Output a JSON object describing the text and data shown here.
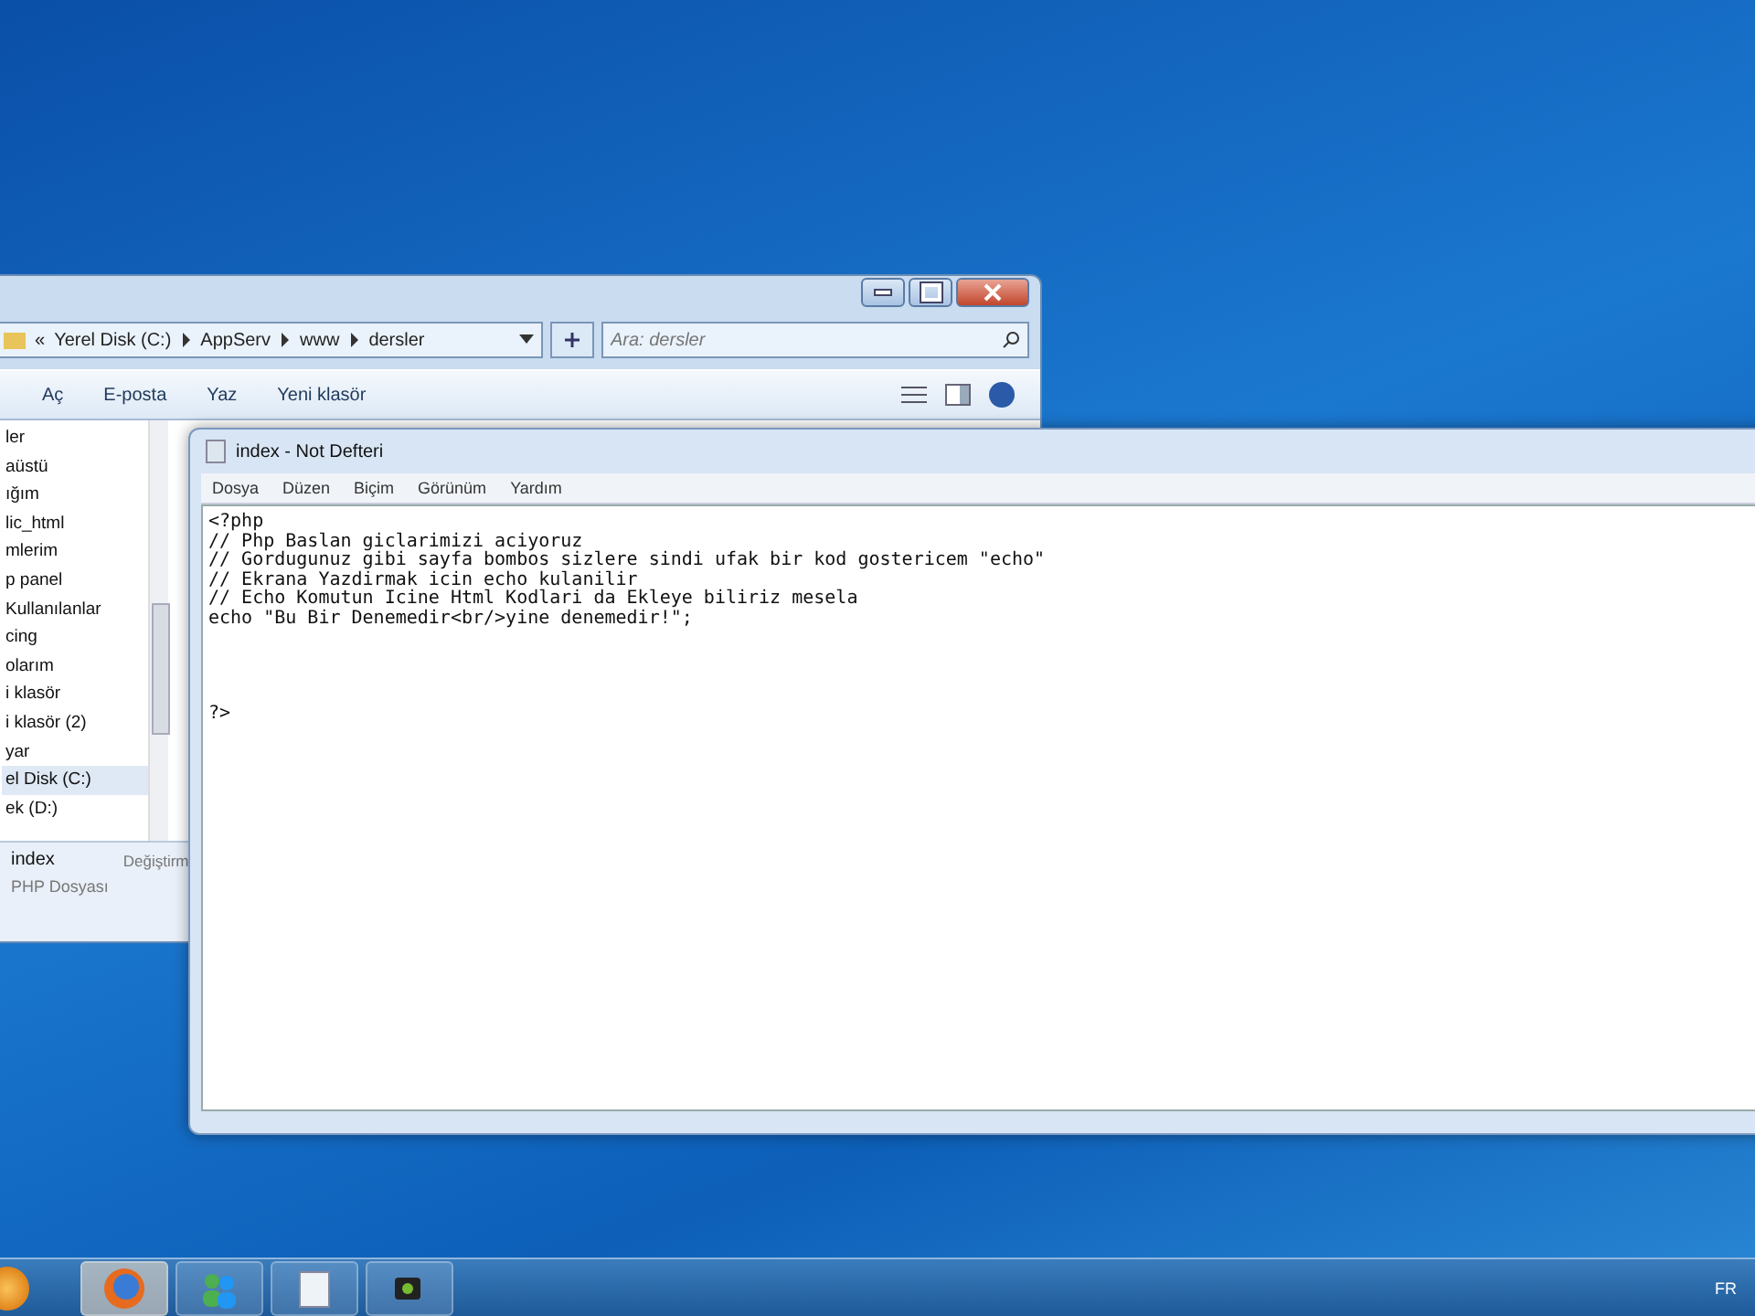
{
  "explorer": {
    "breadcrumb": [
      "«",
      "Yerel Disk (C:)",
      "AppServ",
      "www",
      "dersler"
    ],
    "search": {
      "placeholder": "Ara: dersler"
    },
    "toolbar": [
      "Aç",
      "E-posta",
      "Yaz",
      "Yeni klasör"
    ],
    "nav_items": [
      {
        "label": "ler",
        "selected": false
      },
      {
        "label": "aüstü",
        "selected": false
      },
      {
        "label": "ığım",
        "selected": false
      },
      {
        "label": "lic_html",
        "selected": false
      },
      {
        "label": "mlerim",
        "selected": false
      },
      {
        "label": "p panel",
        "selected": false
      },
      {
        "label": "Kullanılanlar",
        "selected": false
      },
      {
        "label": "cing",
        "selected": false
      },
      {
        "label": "olarım",
        "selected": false
      },
      {
        "label": "i klasör",
        "selected": false
      },
      {
        "label": "i klasör (2)",
        "selected": false
      },
      {
        "label": "yar",
        "selected": false
      },
      {
        "label": "el Disk (C:)",
        "selected": true
      },
      {
        "label": "ek (D:)",
        "selected": false
      }
    ],
    "details": {
      "name": "index",
      "type": "PHP Dosyası",
      "column": "Değiştirm"
    }
  },
  "notepad": {
    "title": "index - Not Defteri",
    "menu": [
      "Dosya",
      "Düzen",
      "Biçim",
      "Görünüm",
      "Yardım"
    ],
    "text": "<?php\n// Php Baslan giclarimizi aciyoruz\n// Gordugunuz gibi sayfa bombos sizlere sindi ufak bir kod gostericem \"echo\"\n// Ekrana Yazdirmak icin echo kulanilir\n// Echo Komutun Icine Html Kodlari da Ekleye biliriz mesela\necho \"Bu Bir Denemedir<br/>yine denemedir!\";\n\n\n\n\n?>"
  },
  "taskbar": {
    "apps": [
      {
        "kind": "browser",
        "selected": true
      },
      {
        "kind": "messenger",
        "selected": false
      },
      {
        "kind": "notepad",
        "selected": false
      },
      {
        "kind": "camera",
        "selected": false
      }
    ],
    "language": "FR"
  }
}
